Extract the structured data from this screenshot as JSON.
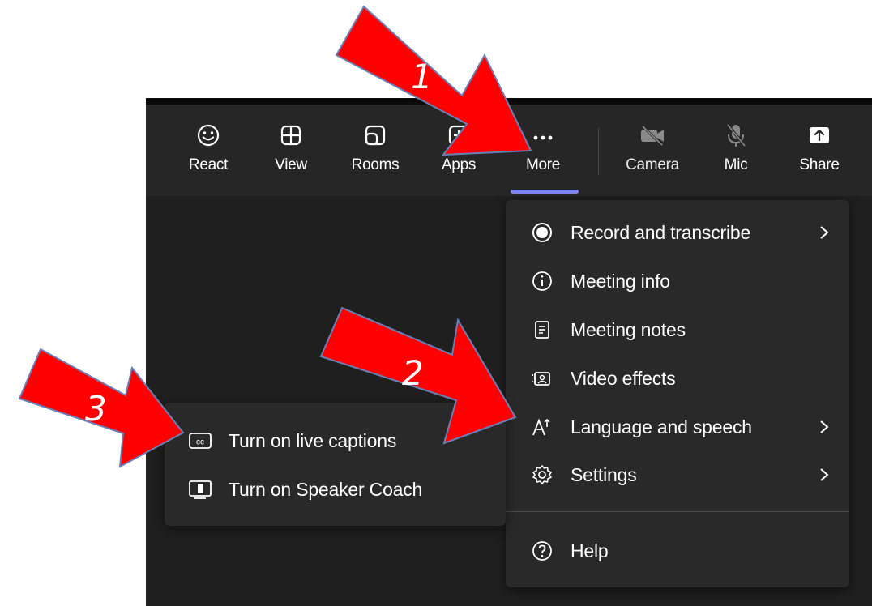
{
  "toolbar": {
    "buttons": [
      {
        "label": "React",
        "icon": "smiley-icon"
      },
      {
        "label": "View",
        "icon": "grid-icon"
      },
      {
        "label": "Rooms",
        "icon": "rooms-icon"
      },
      {
        "label": "Apps",
        "icon": "apps-plus-icon"
      },
      {
        "label": "More",
        "icon": "ellipsis-icon",
        "selected": true
      },
      {
        "label": "Camera",
        "icon": "camera-off-icon"
      },
      {
        "label": "Mic",
        "icon": "mic-off-icon"
      },
      {
        "label": "Share",
        "icon": "share-icon"
      }
    ],
    "accent_color": "#7f85f5"
  },
  "more_menu": {
    "items": [
      {
        "label": "Record and transcribe",
        "icon": "record-icon",
        "has_submenu": true
      },
      {
        "label": "Meeting info",
        "icon": "info-icon",
        "has_submenu": false
      },
      {
        "label": "Meeting notes",
        "icon": "notes-icon",
        "has_submenu": false
      },
      {
        "label": "Video effects",
        "icon": "video-effects-icon",
        "has_submenu": false
      },
      {
        "label": "Language and speech",
        "icon": "language-icon",
        "has_submenu": true
      },
      {
        "label": "Settings",
        "icon": "gear-icon",
        "has_submenu": true
      }
    ],
    "help": {
      "label": "Help",
      "icon": "help-icon"
    }
  },
  "language_submenu": {
    "items": [
      {
        "label": "Turn on live captions",
        "icon": "cc-icon"
      },
      {
        "label": "Turn on Speaker Coach",
        "icon": "speaker-coach-icon"
      }
    ]
  },
  "annotations": {
    "arrow_color": "#ff0000",
    "steps": [
      "1",
      "2",
      "3"
    ]
  }
}
